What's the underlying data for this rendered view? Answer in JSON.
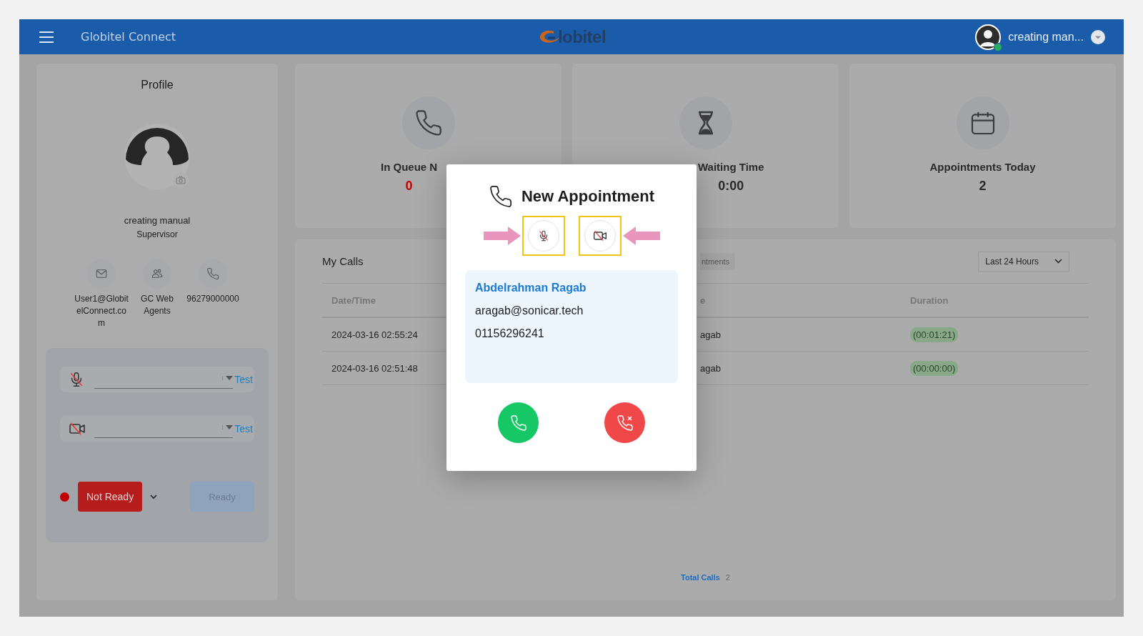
{
  "header": {
    "title": "Globitel Connect",
    "logo": "lobitel",
    "user": "creating man...",
    "online": true
  },
  "profile": {
    "title": "Profile",
    "name": "creating manual",
    "role": "Supervisor",
    "contacts": [
      {
        "kind": "email",
        "text": "User1@GlobitelConnect.com"
      },
      {
        "kind": "group",
        "text": "GC Web Agents"
      },
      {
        "kind": "phone",
        "text": "96279000000"
      }
    ]
  },
  "devices": [
    {
      "kind": "mic",
      "muted": true,
      "action": "Test"
    },
    {
      "kind": "camera",
      "muted": true,
      "action": "Test"
    }
  ],
  "agent_state": {
    "buttons": [
      {
        "kind": "not-ready",
        "label": "Not Ready",
        "disabled": false,
        "selected": true
      },
      {
        "kind": "ready",
        "label": "Ready",
        "disabled": true,
        "selected": false
      }
    ]
  },
  "stats": [
    {
      "kind": "queue",
      "title": "In Queue N",
      "value": "0",
      "color": "#c00000"
    },
    {
      "kind": "waiting",
      "title": "Waiting Time",
      "value": "0:00",
      "color": "#2a2a2a"
    },
    {
      "kind": "appointments",
      "title": "Appointments Today",
      "value": "2",
      "color": "#2a2a2a"
    }
  ],
  "calls": {
    "title": "My Calls",
    "tab": "ntments",
    "filter": "Last 24 Hours",
    "columns": [
      "Date/Time",
      "e",
      "Duration"
    ],
    "rows": [
      {
        "cells": [
          "2024-03-16 02:55:24",
          "agab",
          "(00:01:21)"
        ]
      },
      {
        "cells": [
          "2024-03-16 02:51:48",
          "agab",
          "(00:00:00)"
        ]
      }
    ],
    "total_label": "Total Calls",
    "total": "2"
  },
  "modal": {
    "title": "New Appointment",
    "toggles": [
      {
        "kind": "mic",
        "muted": true,
        "highlighted": true
      },
      {
        "kind": "camera",
        "muted": true,
        "highlighted": true
      }
    ],
    "caller": {
      "name": "Abdelrahman Ragab",
      "email": "aragab@sonicar.tech",
      "phone": "01156296241"
    },
    "actions": [
      {
        "kind": "accept"
      },
      {
        "kind": "decline"
      }
    ]
  }
}
